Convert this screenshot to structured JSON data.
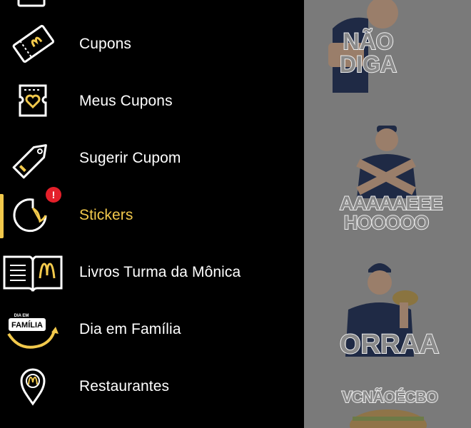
{
  "menu": {
    "items": [
      {
        "label": "",
        "icon": "ticket-box-icon"
      },
      {
        "label": "Cupons",
        "icon": "coupon-ticket-icon"
      },
      {
        "label": "Meus Cupons",
        "icon": "heart-ticket-icon"
      },
      {
        "label": "Sugerir Cupom",
        "icon": "price-tag-icon"
      },
      {
        "label": "Stickers",
        "icon": "sticker-icon",
        "active": true,
        "badge": "!"
      },
      {
        "label": "Livros Turma da Mônica",
        "icon": "open-book-icon"
      },
      {
        "label": "Dia em Família",
        "icon": "dia-em-familia-logo-icon"
      },
      {
        "label": "Restaurantes",
        "icon": "map-pin-icon"
      }
    ]
  },
  "stickers": {
    "items": [
      {
        "caption": "NÃO\nDIGA"
      },
      {
        "caption": "AAAAAEEE\nHOOOOO"
      },
      {
        "caption": "ORRAA"
      },
      {
        "caption": "VCNÃOÉCBO"
      }
    ]
  },
  "colors": {
    "accent": "#f2c94c",
    "badge": "#e4202a",
    "background": "#000000",
    "overlay": "#7a7a7a"
  }
}
